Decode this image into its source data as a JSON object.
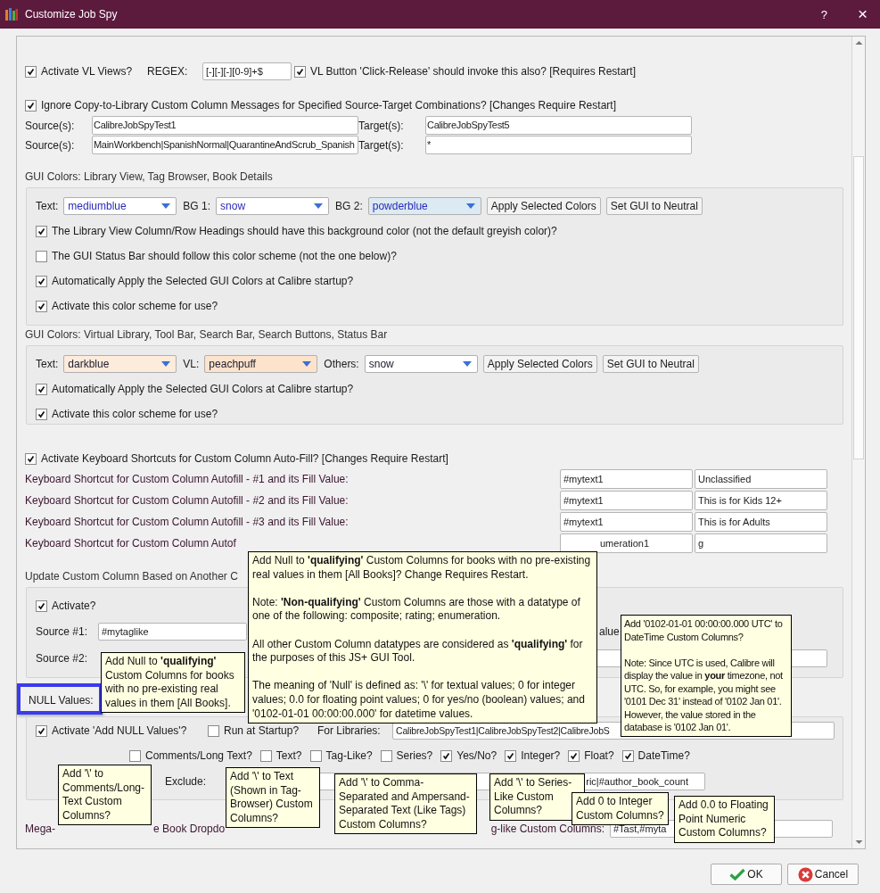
{
  "window": {
    "title": "Customize Job Spy",
    "help": "?",
    "close": "×"
  },
  "vl_views": {
    "activate": {
      "label": "Activate VL Views?",
      "checked": true
    },
    "regex_label": "REGEX:",
    "regex": "[-][-][-][0-9]+$",
    "click_release": {
      "label": "VL Button 'Click-Release' should invoke this also? [Requires Restart]",
      "checked": true
    }
  },
  "copy_to_library": {
    "ignore": {
      "label": "Ignore Copy-to-Library Custom Column Messages for Specified Source-Target Combinations? [Changes Require Restart]",
      "checked": true
    },
    "rows": [
      {
        "source_label": "Source(s):",
        "source": "CalibreJobSpyTest1",
        "target_label": "Target(s):",
        "target": "CalibreJobSpyTest5"
      },
      {
        "source_label": "Source(s):",
        "source": "MainWorkbench|SpanishNormal|QuarantineAndScrub_Spanish",
        "target_label": "Target(s):",
        "target": "*"
      }
    ]
  },
  "gui_colors": [
    {
      "heading": "GUI Colors: Library View, Tag Browser, Book Details",
      "combos": [
        {
          "label": "Text:",
          "value": "mediumblue",
          "color": "#ffffff"
        },
        {
          "label": "BG 1:",
          "value": "snow",
          "color": "#ffffff"
        },
        {
          "label": "BG 2:",
          "value": "powderblue",
          "color": "#dbeaf3"
        }
      ],
      "buttons": [
        "Apply Selected Colors",
        "Set GUI to Neutral"
      ],
      "options": [
        {
          "label": "The Library View Column/Row Headings should have this background color (not the default greyish color)?",
          "checked": true
        },
        {
          "label": "The GUI Status Bar should follow this color scheme (not the one below)?",
          "checked": false
        },
        {
          "label": "Automatically Apply the Selected GUI Colors at Calibre startup?",
          "checked": true
        },
        {
          "label": "Activate this color scheme for use?",
          "checked": true
        }
      ]
    },
    {
      "heading": "GUI Colors: Virtual Library, Tool Bar, Search Bar, Search Buttons, Status Bar",
      "combos": [
        {
          "label": "Text:",
          "value": "darkblue",
          "color": "#fdebdc"
        },
        {
          "label": "VL:",
          "value": "peachpuff",
          "color": "#fde3cc"
        },
        {
          "label": "Others:",
          "value": "snow",
          "color": "#ffffff"
        }
      ],
      "buttons": [
        "Apply Selected Colors",
        "Set GUI to Neutral"
      ],
      "options": [
        {
          "label": "Automatically Apply the Selected GUI Colors at Calibre startup?",
          "checked": true
        },
        {
          "label": "Activate this color scheme for use?",
          "checked": true
        }
      ]
    }
  ],
  "autofill": {
    "activate": {
      "label": "Activate Keyboard Shortcuts for Custom Column Auto-Fill? [Changes Require Restart]",
      "checked": true
    },
    "rows": [
      {
        "label": "Keyboard Shortcut for Custom Column Autofill - #1 and its Fill Value:",
        "column": "#mytext1",
        "value": "Unclassified",
        "clipped": false
      },
      {
        "label": "Keyboard Shortcut for Custom Column Autofill - #2 and its Fill Value:",
        "column": "#mytext1",
        "value": "This is for Kids 12+",
        "clipped": false
      },
      {
        "label": "Keyboard Shortcut for Custom Column Autofill - #3 and its Fill Value:",
        "column": "#mytext1",
        "value": "This is for Adults",
        "clipped": false
      },
      {
        "label": "Keyboard Shortcut for Custom Column Autof",
        "column": "umeration1",
        "value": "g",
        "clipped": true
      }
    ]
  },
  "update_column": {
    "heading": "Update Custom Column Based on Another C",
    "activate": {
      "label": "Activate?",
      "checked": true
    },
    "source1_label": "Source #1:",
    "source1": "#mytaglike",
    "value_fragment": "alue",
    "source2_label": "Source #2:"
  },
  "null_values": {
    "label": "NULL Values:",
    "highlighted": true,
    "activate": {
      "label": "Activate 'Add NULL Values'?",
      "checked": true
    },
    "run_at_startup": {
      "label": "Run at Startup?",
      "checked": false
    },
    "libraries_label": "For Libraries:",
    "libraries": "CalibreJobSpyTest1|CalibreJobSpyTest2|CalibreJobS",
    "types": [
      {
        "label": "Comments/Long Text?",
        "checked": false
      },
      {
        "label": "Text?",
        "checked": false
      },
      {
        "label": "Tag-Like?",
        "checked": false
      },
      {
        "label": "Series?",
        "checked": false
      },
      {
        "label": "Yes/No?",
        "checked": true
      },
      {
        "label": "Integer?",
        "checked": true
      },
      {
        "label": "Float?",
        "checked": true
      },
      {
        "label": "DateTime?",
        "checked": true
      }
    ],
    "exclude_label": "Exclude:",
    "exclude": "ric|#author_book_count"
  },
  "mega": {
    "fragments": [
      "Mega-",
      "e Book Dropdo",
      "g-like Custom Columns:"
    ],
    "value": "#Tast,#myta"
  },
  "tooltips": [
    {
      "paragraphs": [
        "Add Null to **'qualifying'** Custom Columns for books with no pre-existing real values in them [All Books]? Change Requires Restart.",
        "Note: **'Non-qualifying'** Custom Columns are those with a datatype of one of the following: composite; rating; enumeration.",
        "All other Custom Column datatypes are considered as **'qualifying'** for the purposes of this JS+ GUI Tool.",
        "The meaning of 'Null' is defined as: '\\' for textual values; 0 for integer values; 0.0 for floating point values; 0 for yes/no (boolean) values; and '0102-01-01 00:00:00.000' for datetime values."
      ]
    },
    {
      "paragraphs": [
        "Add Null to **'qualifying'** Custom Columns for books with no pre-existing real values in them [All Books]."
      ]
    },
    {
      "paragraphs": [
        "Add '0102-01-01 00:00:00.000 UTC' to DateTime Custom Columns?",
        "Note: Since UTC is used, Calibre will display the value in **your** timezone, not UTC. So, for example, you might see '0101 Dec 31' instead of '0102 Jan 01'. However, the value stored in the database is '0102 Jan 01'."
      ]
    },
    {
      "paragraphs": [
        "Add '\\' to Comments/Long-Text Custom Columns?"
      ]
    },
    {
      "paragraphs": [
        "Add '\\' to Text (Shown in Tag-Browser) Custom Columns?"
      ]
    },
    {
      "paragraphs": [
        "Add '\\' to Comma-Separated and Ampersand-Separated Text (Like Tags) Custom Columns?"
      ]
    },
    {
      "paragraphs": [
        "Add '\\' to Series-Like Custom Columns?"
      ]
    },
    {
      "paragraphs": [
        "Add 0 to Integer Custom Columns?"
      ]
    },
    {
      "paragraphs": [
        "Add 0.0 to Floating Point Numeric Custom Columns?"
      ]
    }
  ],
  "buttons": [
    {
      "kind": "ok",
      "label": "OK"
    },
    {
      "kind": "cancel",
      "label": "Cancel"
    }
  ]
}
